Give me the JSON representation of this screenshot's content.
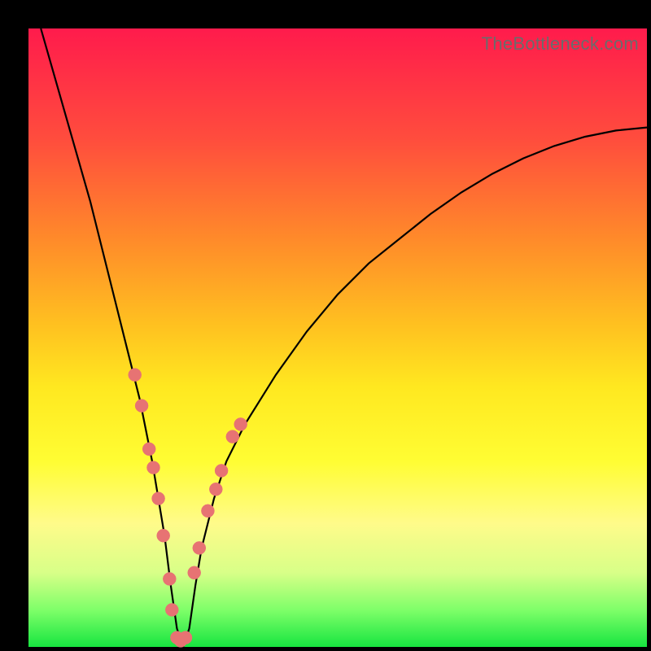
{
  "watermark": "TheBottleneck.com",
  "chart_data": {
    "type": "line",
    "title": "",
    "xlabel": "",
    "ylabel": "",
    "xlim": [
      0,
      100
    ],
    "ylim": [
      0,
      100
    ],
    "grid": false,
    "series": [
      {
        "name": "bottleneck-curve",
        "x": [
          2,
          4,
          6,
          8,
          10,
          12,
          14,
          16,
          18,
          20,
          21,
          22,
          23,
          24,
          25,
          26,
          27,
          28,
          30,
          32,
          35,
          40,
          45,
          50,
          55,
          60,
          65,
          70,
          75,
          80,
          85,
          90,
          95,
          100
        ],
        "y": [
          100,
          93,
          86,
          79,
          72,
          64,
          56,
          48,
          40,
          30,
          24,
          18,
          10,
          3,
          0,
          3,
          10,
          16,
          24,
          30,
          36,
          44,
          51,
          57,
          62,
          66,
          70,
          73.5,
          76.5,
          79,
          81,
          82.5,
          83.5,
          84
        ]
      }
    ],
    "markers": {
      "name": "highlight-points",
      "x": [
        17.2,
        18.3,
        19.5,
        20.2,
        21.0,
        21.8,
        22.8,
        23.2,
        24.0,
        24.6,
        25.4,
        26.8,
        27.6,
        29.0,
        30.3,
        31.2,
        33.0,
        34.3
      ],
      "y": [
        44.0,
        39.0,
        32.0,
        29.0,
        24.0,
        18.0,
        11.0,
        6.0,
        1.5,
        1.0,
        1.5,
        12.0,
        16.0,
        22.0,
        25.5,
        28.5,
        34.0,
        36.0
      ]
    },
    "gradient_bands": [
      {
        "pos": 0,
        "color": "#ff1b4c"
      },
      {
        "pos": 18,
        "color": "#ff4d3d"
      },
      {
        "pos": 34,
        "color": "#ff8a2a"
      },
      {
        "pos": 48,
        "color": "#ffc120"
      },
      {
        "pos": 58,
        "color": "#ffe820"
      },
      {
        "pos": 70,
        "color": "#fffd33"
      },
      {
        "pos": 80,
        "color": "#fffb8a"
      },
      {
        "pos": 88,
        "color": "#d8ff88"
      },
      {
        "pos": 94,
        "color": "#7fff69"
      },
      {
        "pos": 100,
        "color": "#17e540"
      }
    ]
  }
}
